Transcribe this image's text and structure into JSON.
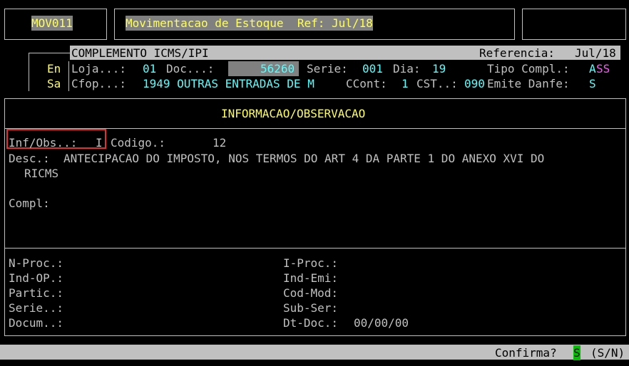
{
  "header": {
    "program_code": "MOV011",
    "title": "Movimentacao de Estoque  Ref: Jul/18"
  },
  "sidebar": {
    "entry": "En",
    "exit": "Sa"
  },
  "complement": {
    "title": "COMPLEMENTO ICMS/IPI",
    "reference_label": "Referencia:",
    "reference_value": "Jul/18",
    "loja_label": "Loja...:",
    "loja_value": "01",
    "doc_label": "Doc...:",
    "doc_value": "56260",
    "serie_label": "Serie:",
    "serie_value": "001",
    "dia_label": "Dia:",
    "dia_value": "19",
    "tipo_label": "Tipo Compl.:",
    "tipo_value_a": "A",
    "tipo_value_rest": "SS",
    "cfop_label": "Cfop...:",
    "cfop_value": "1949 OUTRAS ENTRADAS DE M",
    "ccont_label": "CCont:",
    "ccont_value": "1",
    "cst_label": "CST..:",
    "cst_value": "090",
    "danfe_label": "Emite Danfe:",
    "danfe_value": "S"
  },
  "info": {
    "title": "INFORMACAO/OBSERVACAO",
    "infobs_label": "Inf/Obs..:",
    "infobs_value": "I",
    "codigo_label": "Codigo.:",
    "codigo_value": "12",
    "desc_label": "Desc.:",
    "desc_line1": "ANTECIPACAO DO IMPOSTO, NOS TERMOS DO ART 4 DA PARTE 1 DO ANEXO XVI DO",
    "desc_line2": "RICMS",
    "compl_label": "Compl:"
  },
  "process": {
    "nproc_label": "N-Proc.:",
    "indop_label": "Ind-OP.:",
    "partic_label": "Partic.:",
    "serie_label": "Serie..:",
    "docum_label": "Docum..:",
    "iproc_label": "I-Proc.:",
    "indemi_label": "Ind-Emi:",
    "codmod_label": "Cod-Mod:",
    "subser_label": "Sub-Ser:",
    "dtdoc_label": "Dt-Doc.:",
    "dtdoc_value": "00/00/00"
  },
  "footer": {
    "confirm_label": "Confirma?",
    "confirm_value": "S",
    "confirm_options": "(S/N)"
  }
}
